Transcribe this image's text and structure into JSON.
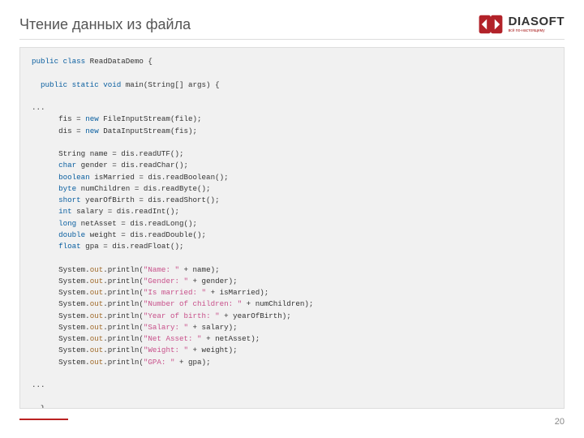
{
  "title": "Чтение данных из файла",
  "logo": {
    "name": "DIASOFT",
    "tagline": "всё по-настоящему"
  },
  "page_number": "20",
  "code": {
    "l1a": "public class",
    "l1b": " ReadDataDemo {",
    "l2a": "public static void",
    "l2b": " main(String[] args) {",
    "ell": "...",
    "l3a": "fis = ",
    "l3b": "new",
    "l3c": " FileInputStream(file);",
    "l4a": "dis = ",
    "l4b": "new",
    "l4c": " DataInputStream(fis);",
    "l5a": "String name = dis.readUTF();",
    "l6a": "char",
    "l6b": " gender = dis.readChar();",
    "l7a": "boolean",
    "l7b": " isMarried = dis.readBoolean();",
    "l8a": "byte",
    "l8b": " numChildren = dis.readByte();",
    "l9a": "short",
    "l9b": " yearOfBirth = dis.readShort();",
    "l10a": "int",
    "l10b": " salary = dis.readInt();",
    "l11a": "long",
    "l11b": " netAsset = dis.readLong();",
    "l12a": "double",
    "l12b": " weight = dis.readDouble();",
    "l13a": "float",
    "l13b": " gpa = dis.readFloat();",
    "sys": "System.",
    "out": "out",
    "pln": ".println(",
    "s1": "\"Name: \"",
    "s1b": " + name);",
    "s2": "\"Gender: \"",
    "s2b": " + gender);",
    "s3": "\"Is married: \"",
    "s3b": " + isMarried);",
    "s4": "\"Number of children: \"",
    "s4b": " + numChildren);",
    "s5": "\"Year of birth: \"",
    "s5b": " + yearOfBirth);",
    "s6": "\"Salary: \"",
    "s6b": " + salary);",
    "s7": "\"Net Asset: \"",
    "s7b": " + netAsset);",
    "s8": "\"Weight: \"",
    "s8b": " + weight);",
    "s9": "\"GPA: \"",
    "s9b": " + gpa);",
    "cb": "}"
  }
}
